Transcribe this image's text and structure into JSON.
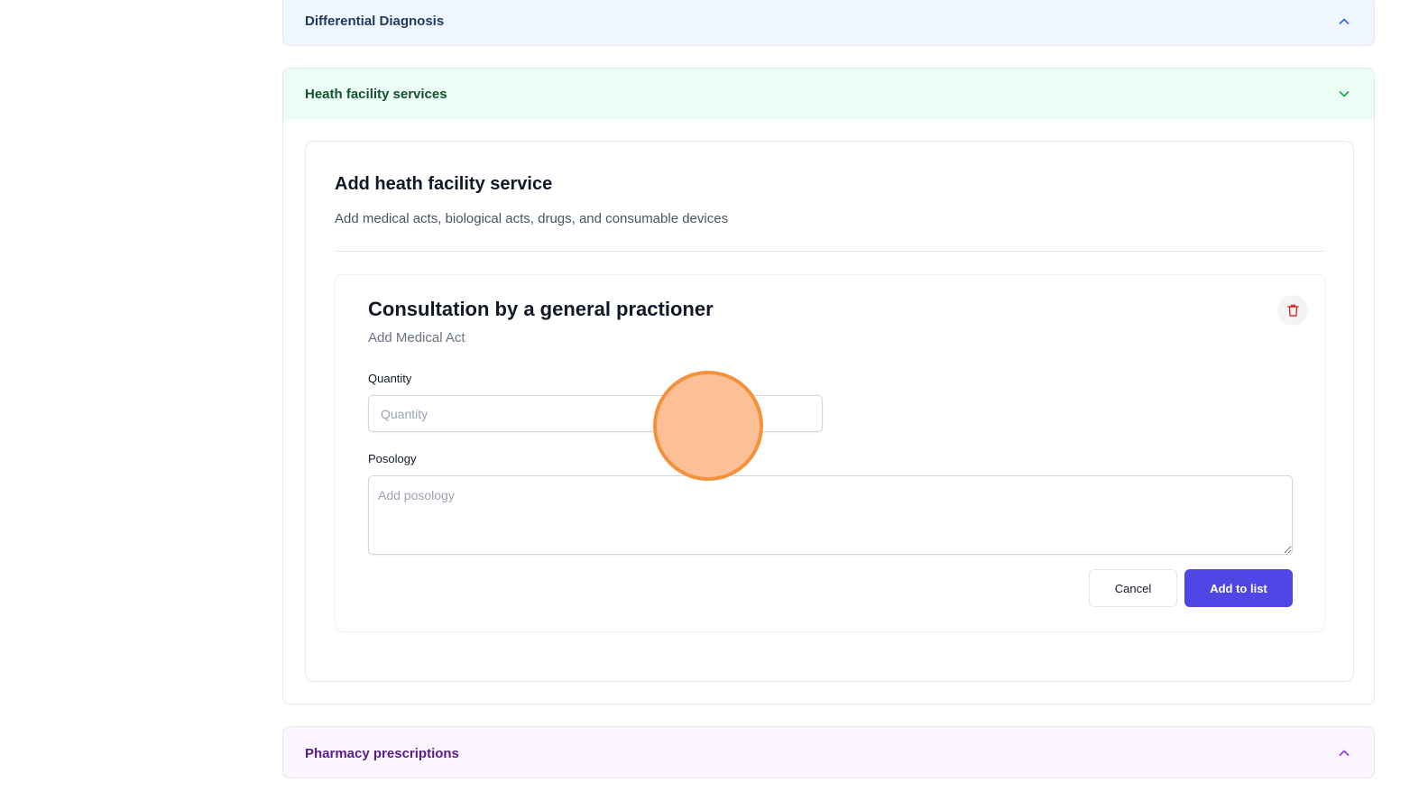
{
  "sections": {
    "differential": {
      "title": "Differential Diagnosis",
      "icon": "chevron-up-icon",
      "color": "#1e3a5f"
    },
    "health": {
      "title": "Heath facility services",
      "icon": "chevron-down-icon",
      "color": "#14532d"
    },
    "pharmacy": {
      "title": "Pharmacy prescriptions",
      "icon": "chevron-up-icon",
      "color": "#581c87"
    }
  },
  "service_form": {
    "title": "Add heath facility service",
    "subtitle": "Add medical acts, biological acts, drugs, and consumable devices",
    "item": {
      "title": "Consultation by a general practioner",
      "type": "Add Medical Act",
      "delete_icon": "trash-icon",
      "quantity": {
        "label": "Quantity",
        "placeholder": "Quantity",
        "value": ""
      },
      "posology": {
        "label": "Posology",
        "placeholder": "Add posology",
        "value": ""
      },
      "cancel_label": "Cancel",
      "add_label": "Add to list"
    }
  },
  "colors": {
    "primary": "#4f46e5",
    "danger": "#dc2626",
    "cursor_highlight": "#f4923c"
  }
}
